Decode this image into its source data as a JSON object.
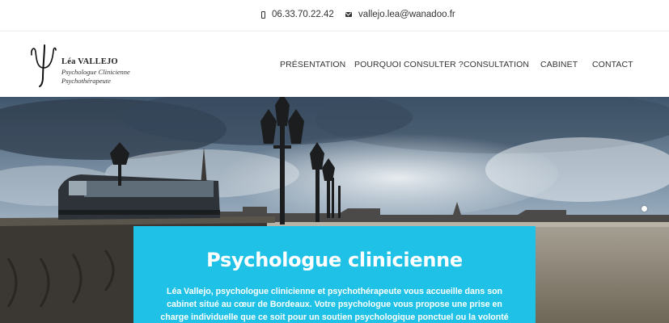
{
  "topbar": {
    "phone": "06.33.70.22.42",
    "email": "vallejo.lea@wanadoo.fr"
  },
  "logo": {
    "symbol": "ψ",
    "name": "Léa VALLEJO",
    "line1": "Psychologue Clinicienne",
    "line2": "Psychothérapeute"
  },
  "nav": {
    "items": [
      {
        "label": "PRÉSENTATION"
      },
      {
        "label": "POURQUOI CONSULTER ?"
      },
      {
        "label": "CONSULTATION"
      },
      {
        "label": "CABINET"
      },
      {
        "label": "CONTACT"
      }
    ]
  },
  "hero": {
    "title": "Psychologue clinicienne",
    "text": "Léa Vallejo, psychologue clinicienne et psychothérapeute vous accueille dans son cabinet situé au cœur de Bordeaux. Votre psychologue vous propose une prise en charge individuelle que ce soit pour un soutien psychologique ponctuel ou la volonté d’entreprendre un travail"
  },
  "colors": {
    "panel": "#1fc2e6",
    "text": "#333333"
  },
  "icons": [
    "phone-icon",
    "mail-icon",
    "psi-logo-icon"
  ]
}
